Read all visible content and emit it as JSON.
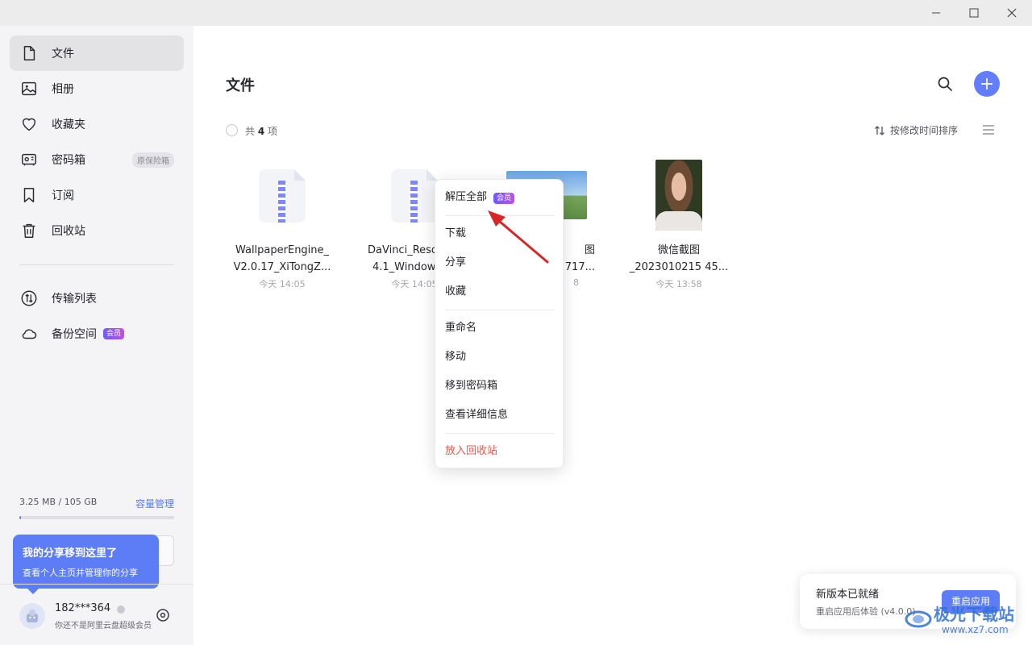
{
  "sidebar": {
    "nav": [
      {
        "label": "文件",
        "icon": "file-icon",
        "active": true
      },
      {
        "label": "相册",
        "icon": "photo-icon"
      },
      {
        "label": "收藏夹",
        "icon": "heart-icon"
      },
      {
        "label": "密码箱",
        "icon": "safe-icon",
        "tag": "原保险箱"
      },
      {
        "label": "订阅",
        "icon": "bookmark-icon"
      },
      {
        "label": "回收站",
        "icon": "trash-icon"
      }
    ],
    "secondary": [
      {
        "label": "传输列表",
        "icon": "transfer-icon"
      },
      {
        "label": "备份空间",
        "icon": "cloud-icon",
        "tag": "会员"
      }
    ],
    "storage": {
      "text": "3.25 MB / 105 GB",
      "link": "容量管理",
      "used_fraction": 0.0
    }
  },
  "tooltip": {
    "title": "我的分享移到这里了",
    "body": "查看个人主页并管理你的分享"
  },
  "user": {
    "name": "182***364",
    "subtitle": "你还不是阿里云盘超级会员"
  },
  "main": {
    "title": "文件",
    "count_prefix": "共",
    "count_value": "4",
    "count_suffix": "项",
    "sort_label": "按修改时间排序"
  },
  "files": [
    {
      "name_line1": "WallpaperEngine_",
      "name_line2": "V2.0.17_XiTongZ...",
      "date": "今天 14:05",
      "thumb": "zip"
    },
    {
      "name_line1": "DaVinci_Reso",
      "name_line2": "4.1_Windows",
      "date": "今天 14:05",
      "thumb": "zip"
    },
    {
      "name_line1": "图",
      "name_line2": "717...",
      "date": "8",
      "thumb": "photo"
    },
    {
      "name_line1": "微信截图",
      "name_line2": "_2023010215 45...",
      "date": "今天 13:58",
      "thumb": "portrait"
    }
  ],
  "context_menu": {
    "items": [
      {
        "label": "解压全部",
        "tag": "会员"
      },
      {
        "label": "下载"
      },
      {
        "label": "分享"
      },
      {
        "label": "收藏"
      },
      {
        "label": "重命名"
      },
      {
        "label": "移动"
      },
      {
        "label": "移到密码箱"
      },
      {
        "label": "查看详细信息"
      },
      {
        "label": "放入回收站",
        "danger": true
      }
    ]
  },
  "update": {
    "title": "新版本已就绪",
    "subtitle": "重启应用后体验 (v4.0.0)",
    "button": "重启应用"
  },
  "watermark": {
    "line1": "极光下载站",
    "line2": "www.xz7.com"
  },
  "colors": {
    "accent": "#637dff",
    "danger": "#ec5a4f",
    "sidebar_bg": "#f4f4f6",
    "tooltip_bg": "#5c7df5",
    "annotation_arrow": "#d62828"
  }
}
